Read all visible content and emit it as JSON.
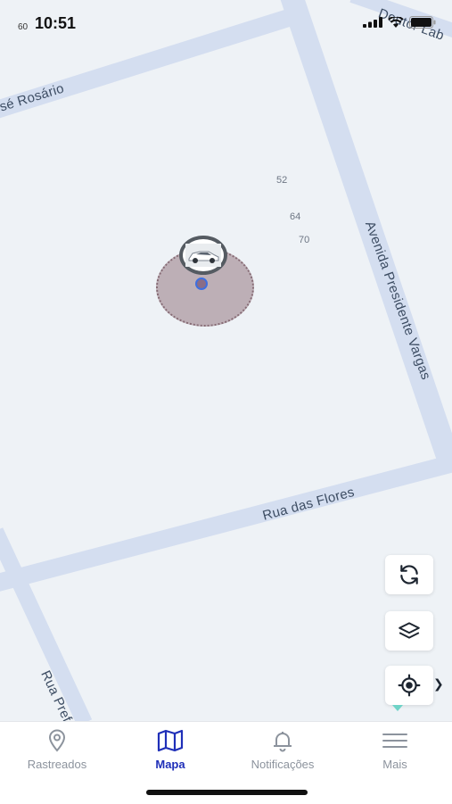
{
  "status_bar": {
    "small_text": "60",
    "time": "10:51"
  },
  "map": {
    "streets": [
      "Doutor Lab",
      "sé Rosário",
      "Avenida Presidente Vargas",
      "Rua das Flores",
      "Rua Prefe"
    ],
    "address_numbers": [
      "52",
      "64",
      "70"
    ],
    "accuracy_color": "#96787f",
    "location_dot_color": "#3e6fe0"
  },
  "controls": {
    "refresh_icon": "refresh-icon",
    "layers_icon": "layers-icon",
    "locate_icon": "locate-icon"
  },
  "tabbar": {
    "tabs": [
      {
        "label": "Rastreados",
        "icon": "pin-icon"
      },
      {
        "label": "Mapa",
        "icon": "map-icon"
      },
      {
        "label": "Notificações",
        "icon": "bell-icon"
      },
      {
        "label": "Mais",
        "icon": "menu-icon"
      }
    ],
    "active_color": "#1f2fb8",
    "inactive_color": "#8c939d"
  }
}
